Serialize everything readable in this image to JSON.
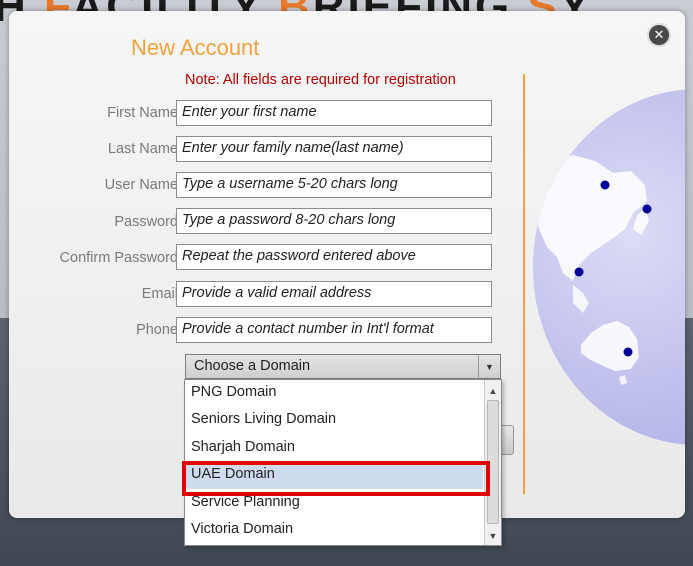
{
  "background": {
    "title_prefix": "H ",
    "title_acc1": "F",
    "title_mid1": "ACILITY ",
    "title_acc2": "B",
    "title_mid2": "RIEFING ",
    "title_acc3": "S",
    "title_end": "Y"
  },
  "modal": {
    "title": "New Account",
    "note": "Note: All fields are required for registration",
    "close_glyph": "✕"
  },
  "form": {
    "fields": [
      {
        "label": "First Name",
        "placeholder": "Enter your first name"
      },
      {
        "label": "Last Name",
        "placeholder": "Enter your family name(last name)"
      },
      {
        "label": "User Name",
        "placeholder": "Type a username 5-20 chars long"
      },
      {
        "label": "Password",
        "placeholder": "Type a password 8-20 chars long"
      },
      {
        "label": "Confirm Password",
        "placeholder": "Repeat the password entered above"
      },
      {
        "label": "Email",
        "placeholder": "Provide a valid email address"
      },
      {
        "label": "Phone",
        "placeholder": "Provide a contact number in Int'l format"
      }
    ],
    "domain_select": {
      "value": "Choose a Domain",
      "arrow": "▼"
    }
  },
  "dropdown": {
    "options": [
      "PNG Domain",
      "Seniors Living Domain",
      "Sharjah Domain",
      "UAE Domain",
      "Service Planning",
      "Victoria Domain"
    ],
    "selected": "UAE Domain",
    "scroll_up": "▲",
    "scroll_down": "▼"
  },
  "colors": {
    "accent_orange": "#f0a23c",
    "note_red": "#b30000",
    "highlight_red": "#e00000",
    "selected_bg": "#cfdcef"
  }
}
